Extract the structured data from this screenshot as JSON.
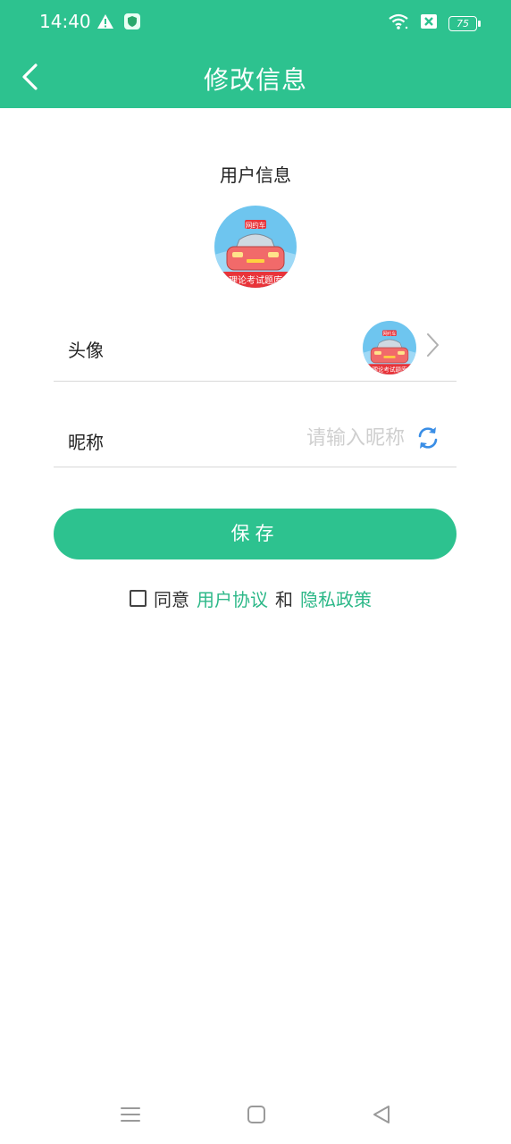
{
  "status_bar": {
    "time": "14:40",
    "battery": "75",
    "icons": [
      "warning-icon",
      "shield-app-icon",
      "wifi-icon",
      "sim-off-icon",
      "battery-icon"
    ]
  },
  "app_bar": {
    "title": "修改信息",
    "back_icon": "chevron-left-icon"
  },
  "user_info": {
    "section_title": "用户信息",
    "avatar_badge": "网约车",
    "avatar_caption": "理论考试题库"
  },
  "form": {
    "avatar_label": "头像",
    "nickname_label": "昵称",
    "nickname_value": "",
    "nickname_placeholder": "请输入昵称"
  },
  "save_button": {
    "label": "保存"
  },
  "agreement": {
    "checked": false,
    "prefix": "同意",
    "user_agreement": "用户协议",
    "conjunction": "和",
    "privacy_policy": "隐私政策"
  },
  "nav_bar": {
    "icons": [
      "menu-icon",
      "home-icon",
      "back-triangle-icon"
    ]
  },
  "colors": {
    "accent": "#2dc28f",
    "link": "#2db888",
    "placeholder": "#cfcfcf",
    "divider": "#d8d8d8"
  }
}
